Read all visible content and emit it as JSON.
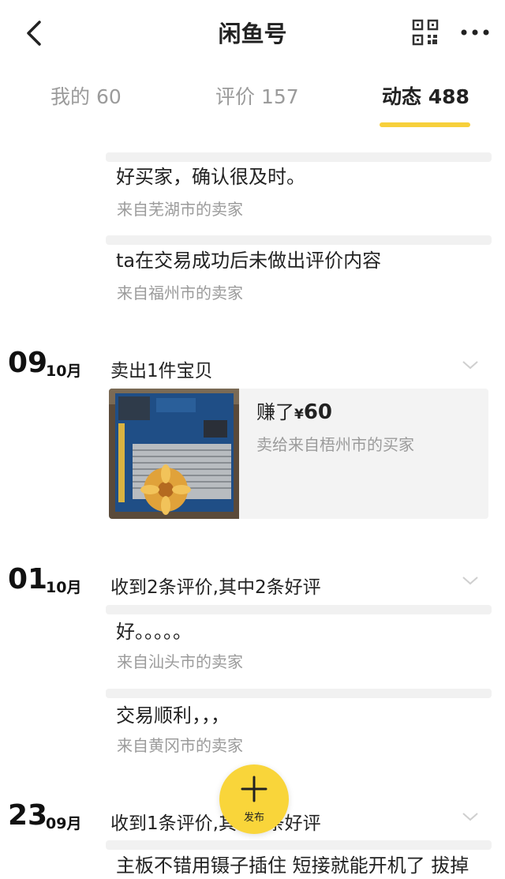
{
  "header": {
    "title": "闲鱼号",
    "icons": [
      "back-icon",
      "qr-code-icon",
      "more-icon"
    ]
  },
  "tabs": [
    {
      "label": "我的 60",
      "active": false
    },
    {
      "label": "评价 157",
      "active": false
    },
    {
      "label": "动态 488",
      "active": true
    }
  ],
  "reviews_top": [
    {
      "text": "好买家，确认很及时。",
      "source": "来自芜湖市的卖家"
    },
    {
      "text": "ta在交易成功后未做出评价内容",
      "source": "来自福州市的卖家"
    }
  ],
  "events": [
    {
      "day": "09",
      "month": "10月",
      "title": "卖出1件宝贝",
      "earn_prefix": "赚了",
      "currency": "¥",
      "amount": "60",
      "buyer": "卖给来自梧州市的买家"
    },
    {
      "day": "01",
      "month": "10月",
      "title": "收到2条评价,其中2条好评",
      "reviews": [
        {
          "text": "好。。。。。",
          "source": "来自汕头市的卖家"
        },
        {
          "text": "交易顺利，，，",
          "source": "来自黄冈市的卖家"
        }
      ]
    },
    {
      "day": "23",
      "month": "09月",
      "title": "收到1条评价,其中1条好评",
      "reviews": [
        {
          "text": "主板不错用镊子插住 短接就能开机了 拔掉"
        }
      ]
    }
  ],
  "publish": {
    "label": "发布"
  },
  "colors": {
    "accent": "#f7d03b",
    "publish_bg": "#f9d53a",
    "muted": "#9b9b9b",
    "separator": "#f1f1f1"
  }
}
